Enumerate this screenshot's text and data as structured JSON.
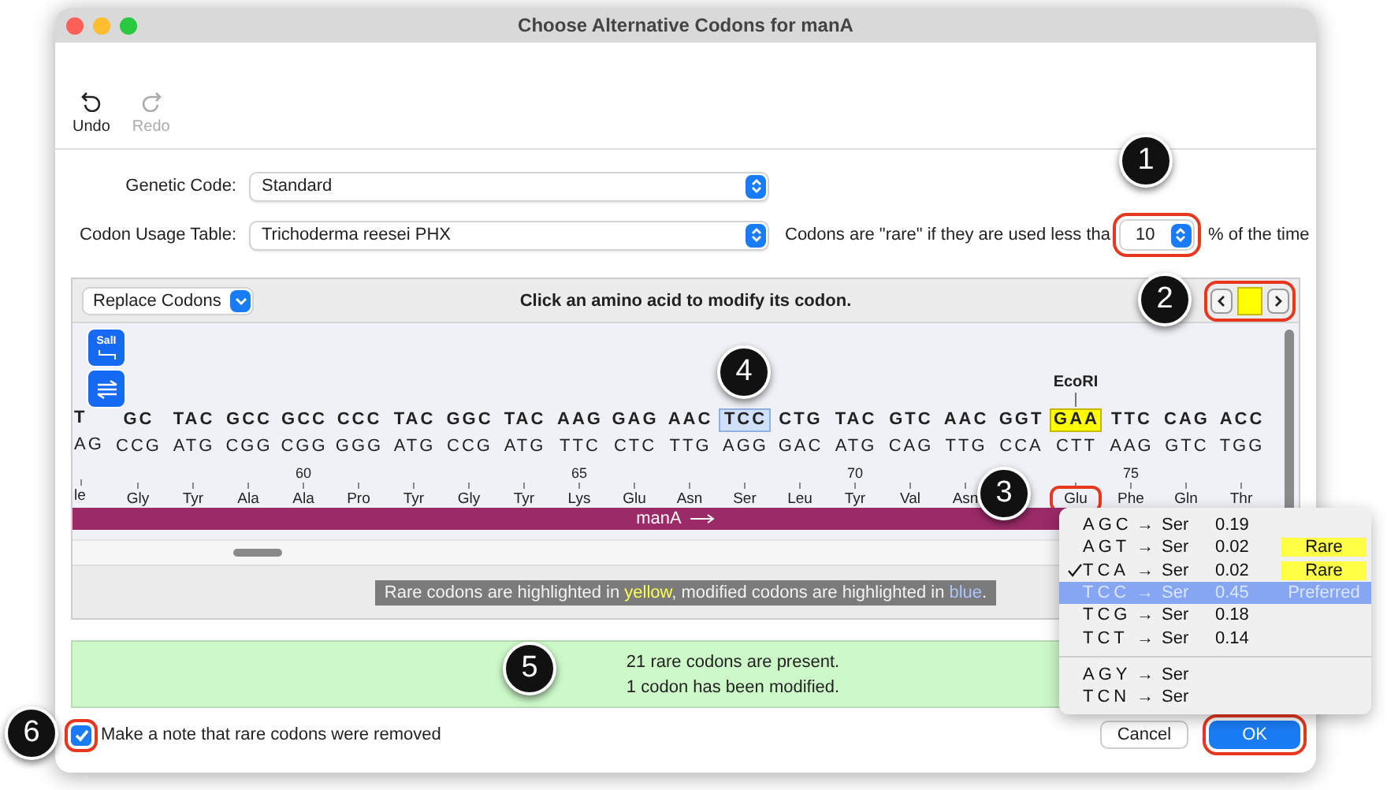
{
  "window": {
    "title": "Choose Alternative Codons for manA"
  },
  "toolbar": [
    {
      "kind": "undo",
      "label": "Undo",
      "disabled": false
    },
    {
      "kind": "redo",
      "label": "Redo",
      "disabled": true
    }
  ],
  "genetic_code": {
    "label": "Genetic Code:",
    "value": "Standard"
  },
  "codon_usage": {
    "label": "Codon Usage Table:",
    "value": "Trichoderma reesei PHX",
    "rare_text": "Codons are \"rare\" if they are used less tha",
    "threshold": "10",
    "threshold_suffix": "% of the time"
  },
  "panel": {
    "mode": "Replace Codons",
    "instruction": "Click an amino acid to modify its codon.",
    "enzyme_button": "SalI"
  },
  "columns": [
    {
      "top": "T",
      "bottom": "AG",
      "aa": "le",
      "rare": false,
      "modified": false
    },
    {
      "top": "GC",
      "bottom": "CCG",
      "aa": "Gly",
      "rare": false,
      "modified": false
    },
    {
      "top": "TAC",
      "bottom": "ATG",
      "aa": "Tyr",
      "rare": false,
      "modified": false
    },
    {
      "top": "GCC",
      "bottom": "CGG",
      "aa": "Ala",
      "rare": false,
      "modified": false
    },
    {
      "top": "GCC",
      "bottom": "CGG",
      "aa": "Ala",
      "number": "60",
      "rare": false,
      "modified": false
    },
    {
      "top": "CCC",
      "bottom": "GGG",
      "aa": "Pro",
      "rare": false,
      "modified": false
    },
    {
      "top": "TAC",
      "bottom": "ATG",
      "aa": "Tyr",
      "rare": false,
      "modified": false
    },
    {
      "top": "GGC",
      "bottom": "CCG",
      "aa": "Gly",
      "rare": false,
      "modified": false
    },
    {
      "top": "TAC",
      "bottom": "ATG",
      "aa": "Tyr",
      "rare": false,
      "modified": false
    },
    {
      "top": "AAG",
      "bottom": "TTC",
      "aa": "Lys",
      "number": "65",
      "rare": false,
      "modified": false
    },
    {
      "top": "GAG",
      "bottom": "CTC",
      "aa": "Glu",
      "rare": false,
      "modified": false
    },
    {
      "top": "AAC",
      "bottom": "TTG",
      "aa": "Asn",
      "rare": false,
      "modified": false
    },
    {
      "top": "TCC",
      "bottom": "AGG",
      "aa": "Ser",
      "rare": false,
      "modified": true
    },
    {
      "top": "CTG",
      "bottom": "GAC",
      "aa": "Leu",
      "rare": false,
      "modified": false
    },
    {
      "top": "TAC",
      "bottom": "ATG",
      "aa": "Tyr",
      "number": "70",
      "rare": false,
      "modified": false
    },
    {
      "top": "GTC",
      "bottom": "CAG",
      "aa": "Val",
      "rare": false,
      "modified": false
    },
    {
      "top": "AAC",
      "bottom": "TTG",
      "aa": "Asn",
      "rare": false,
      "modified": false
    },
    {
      "top": "GGT",
      "bottom": "CCA",
      "rare": false,
      "modified": false
    },
    {
      "top": "GAA",
      "bottom": "CTT",
      "aa": "Glu",
      "site": "EcoRI",
      "rare": true,
      "modified": false,
      "annotated": true
    },
    {
      "top": "TTC",
      "bottom": "AAG",
      "aa": "Phe",
      "number": "75",
      "rare": false,
      "modified": false
    },
    {
      "top": "CAG",
      "bottom": "GTC",
      "aa": "Gln",
      "rare": false,
      "modified": false
    },
    {
      "top": "ACC",
      "bottom": "TGG",
      "aa": "Thr",
      "rare": false,
      "modified": false
    }
  ],
  "feature": {
    "name": "manA"
  },
  "legend": [
    {
      "text": "Rare codons are highlighted in ",
      "kind": "plain"
    },
    {
      "text": "yellow",
      "kind": "rare"
    },
    {
      "text": ", modified codons are highlighted in ",
      "kind": "plain"
    },
    {
      "text": "blue",
      "kind": "modified"
    },
    {
      "text": ".",
      "kind": "plain"
    }
  ],
  "status": [
    "21 rare codons are present.",
    "1 codon has been modified."
  ],
  "note_checkbox": {
    "label": "Make a note that rare codons were removed",
    "checked": true
  },
  "buttons": [
    {
      "label": "Cancel",
      "default": false
    },
    {
      "label": "OK",
      "default": true
    }
  ],
  "menu": [
    [
      {
        "codon": "AGC",
        "arrow": "→",
        "aa": "Ser",
        "freq": "0.19",
        "checked": false,
        "selected": false
      },
      {
        "codon": "AGT",
        "arrow": "→",
        "aa": "Ser",
        "freq": "0.02",
        "tag": {
          "text": "Rare",
          "kind": "rare"
        },
        "checked": false,
        "selected": false
      },
      {
        "codon": "TCA",
        "arrow": "→",
        "aa": "Ser",
        "freq": "0.02",
        "tag": {
          "text": "Rare",
          "kind": "rare"
        },
        "checked": true,
        "selected": false
      },
      {
        "codon": "TCC",
        "arrow": "→",
        "aa": "Ser",
        "freq": "0.45",
        "tag": {
          "text": "Preferred",
          "kind": "preferred"
        },
        "checked": false,
        "selected": true
      },
      {
        "codon": "TCG",
        "arrow": "→",
        "aa": "Ser",
        "freq": "0.18",
        "checked": false,
        "selected": false
      },
      {
        "codon": "TCT",
        "arrow": "→",
        "aa": "Ser",
        "freq": "0.14",
        "checked": false,
        "selected": false
      }
    ],
    [
      {
        "codon": "AGY",
        "arrow": "→",
        "aa": "Ser",
        "checked": false,
        "selected": false
      },
      {
        "codon": "TCN",
        "arrow": "→",
        "aa": "Ser",
        "checked": false,
        "selected": false
      }
    ]
  ],
  "callouts": [
    {
      "number": "1"
    },
    {
      "number": "2"
    },
    {
      "number": "3"
    },
    {
      "number": "4"
    },
    {
      "number": "5"
    },
    {
      "number": "6"
    }
  ]
}
